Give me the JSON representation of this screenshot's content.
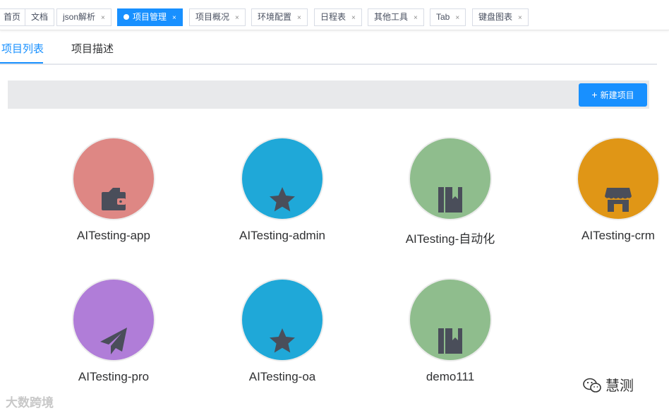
{
  "tabs": [
    {
      "label": "首页",
      "closable": false,
      "active": false
    },
    {
      "label": "文档",
      "closable": false,
      "active": false
    },
    {
      "label": "json解析",
      "closable": true,
      "active": false
    },
    {
      "label": "项目管理",
      "closable": true,
      "active": true
    },
    {
      "label": "项目概况",
      "closable": true,
      "active": false
    },
    {
      "label": "环境配置",
      "closable": true,
      "active": false
    },
    {
      "label": "日程表",
      "closable": true,
      "active": false
    },
    {
      "label": "其他工具",
      "closable": true,
      "active": false
    },
    {
      "label": "Tab",
      "closable": true,
      "active": false
    },
    {
      "label": "键盘图表",
      "closable": true,
      "active": false
    }
  ],
  "tab_close_glyph": "×",
  "subtabs": {
    "list": "项目列表",
    "desc": "项目描述"
  },
  "toolbar": {
    "new_project": "新建项目",
    "plus": "+"
  },
  "projects": [
    {
      "name": "AITesting-app",
      "color": "#de8784",
      "icon": "wallet-icon"
    },
    {
      "name": "AITesting-admin",
      "color": "#1fa8d8",
      "icon": "star-icon"
    },
    {
      "name": "AITesting-自动化",
      "color": "#8fbd8d",
      "icon": "bookmark-book-icon"
    },
    {
      "name": "AITesting-crm",
      "color": "#e09616",
      "icon": "shop-icon"
    },
    {
      "name": "AITesting-pro",
      "color": "#b07dd8",
      "icon": "paper-plane-icon"
    },
    {
      "name": "AITesting-oa",
      "color": "#1fa8d8",
      "icon": "star-icon"
    },
    {
      "name": "demo111",
      "color": "#8fbd8d",
      "icon": "bookmark-book-icon"
    }
  ],
  "watermarks": {
    "left": "大数跨境",
    "right": "慧测"
  },
  "colors": {
    "accent": "#1890ff",
    "icon": "#4a4e5a"
  }
}
